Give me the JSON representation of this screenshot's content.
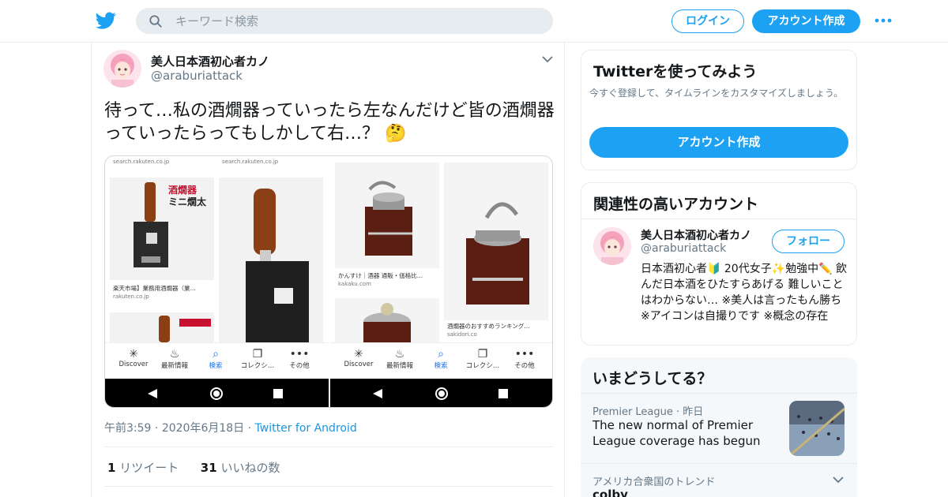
{
  "header": {
    "search_placeholder": "キーワード検索",
    "login_label": "ログイン",
    "signup_label": "アカウント作成"
  },
  "tweet": {
    "author_name": "美人日本酒初心者カノ",
    "author_handle": "@araburiattack",
    "text": "待って…私の酒燗器っていったら左なんだけど皆の酒燗器っていったらってもしかして右…？",
    "emoji": "🤔",
    "time": "午前3:59",
    "date": "2020年6月18日",
    "source": "Twitter for Android",
    "retweet_count": "1",
    "retweet_label": "リツイート",
    "like_count": "31",
    "like_label": "いいねの数"
  },
  "media": {
    "left": {
      "src1": "search.rakuten.co.jp",
      "src2": "search.rakuten.co.jp",
      "product_label_line1": "酒燗器",
      "product_label_line2": "ミニ燗太",
      "caption": "楽天市場】業務用酒燗器（業…",
      "caption_src": "rakuten.co.jp"
    },
    "right": {
      "caption1": "かんすけ｜酒器 通販・価格比…",
      "caption1_src": "kakaku.com",
      "caption2": "酒燗器のおすすめランキング…",
      "caption2_src": "sakidori.co"
    },
    "nav": {
      "discover": "Discover",
      "updates": "最新情報",
      "search": "検索",
      "collections": "コレクシ…",
      "more": "その他"
    }
  },
  "sidebar": {
    "try_title": "Twitterを使ってみよう",
    "try_desc": "今すぐ登録して、タイムラインをカスタマイズしましょう。",
    "try_button": "アカウント作成",
    "related_title": "関連性の高いアカウント",
    "related_name": "美人日本酒初心者カノ",
    "related_handle": "@araburiattack",
    "follow_label": "フォロー",
    "related_bio": "日本酒初心者🔰 20代女子✨勉強中✏️ 飲んだ日本酒をひたすらあげる 難しいことはわからない… ※美人は言ったもん勝ち ※アイコンは自撮りです ※概念の存在",
    "trends_title": "いまどうしてる？",
    "trend1_source": "Premier League",
    "trend1_time": "昨日",
    "trend1_text": "The new normal of Premier League coverage has begun",
    "trend2_location": "アメリカ合衆国のトレンド",
    "trend2_text": "colby"
  },
  "colors": {
    "accent": "#1da1f2",
    "text": "#14171a",
    "muted": "#657786",
    "border": "#e6ecf0"
  }
}
